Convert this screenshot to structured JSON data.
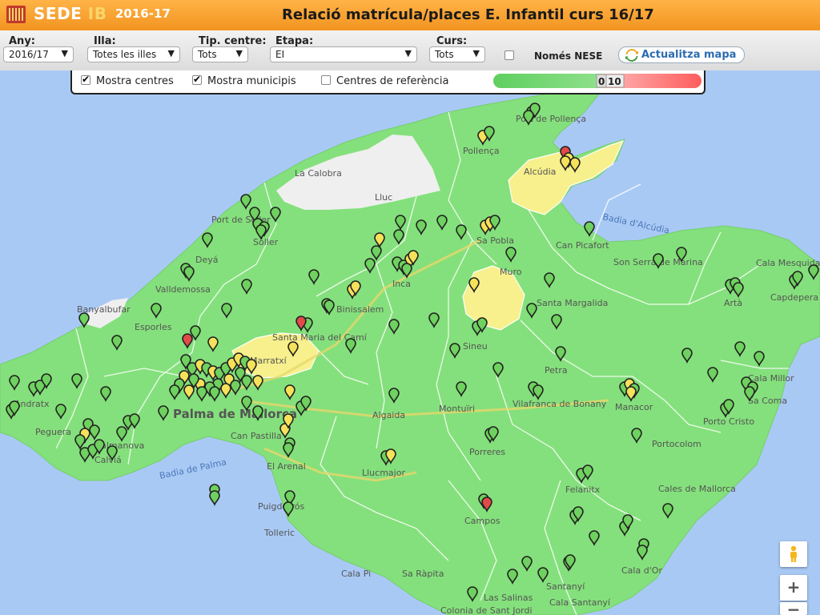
{
  "header": {
    "logo_main": "SEDE ",
    "logo_ib": "IB",
    "year": "2016-17",
    "title": "Relació matrícula/places E. Infantil curs 16/17",
    "colors": {
      "bar": "#f29421",
      "logo_ib": "#f8d56a"
    }
  },
  "filters": {
    "any": {
      "label": "Any:",
      "value": "2016/17"
    },
    "illa": {
      "label": "Illa:",
      "value": "Totes les illes"
    },
    "tip_centre": {
      "label": "Tip. centre:",
      "value": "Tots"
    },
    "etapa": {
      "label": "Etapa:",
      "value": "EI"
    },
    "curs": {
      "label": "Curs:",
      "value": "Tots"
    },
    "nese": {
      "label": "Només NESE",
      "checked": false
    },
    "refresh": {
      "label": "Actualitza mapa",
      "icon": "refresh-icon"
    }
  },
  "map_options": {
    "mostra_centres": {
      "label": "Mostra centres",
      "checked": true
    },
    "mostra_municipis": {
      "label": "Mostra municipis",
      "checked": true
    },
    "centres_referencia": {
      "label": "Centres de referència",
      "checked": false
    },
    "legend": {
      "min_label": "0",
      "max_label": "10",
      "colors": [
        "#5fcf5f",
        "#ff5c5c"
      ]
    }
  },
  "map": {
    "colors": {
      "sea": "#a9c9f5",
      "green": "#84e07c",
      "yellow": "#f7f08c",
      "white": "#efefef",
      "road": "#e6d86c"
    },
    "place_labels": [
      "Port de Pollença",
      "Pollença",
      "Alcúdia",
      "La Calobra",
      "Lluc",
      "Port de Sóller",
      "Sóller",
      "Deyá",
      "Valldemossa",
      "Banyalbufar",
      "Esporles",
      "Santa Maria del Camí",
      "Binissalem",
      "Inca",
      "Sa Pobla",
      "Muro",
      "Can Picafort",
      "Son Serra de Marina",
      "Santa Margalida",
      "Artà",
      "Cala Mesquida",
      "Capdepera",
      "Sineu",
      "Petra",
      "Cala Millor",
      "Sa Coma",
      "Manacor",
      "Porto Cristo",
      "Andratx",
      "Peguera",
      "Palmanova",
      "Calviá",
      "Palma de Mallorca",
      "Marratxí",
      "Can Pastilla",
      "Algaida",
      "Montuïri",
      "Vilafranca de Bonany",
      "Porreres",
      "El Arenal",
      "Llucmajor",
      "Felanitx",
      "Portocolom",
      "Cales de Mallorca",
      "Campos",
      "Puigderrós",
      "Tolleric",
      "Cala Pi",
      "Sa Ràpita",
      "Santanyí",
      "Cala d'Or",
      "Las Salinas",
      "Cala Santanyí",
      "Colonia de Sant Jordi",
      "Badia de Palma",
      "Badia d'Alcúdia"
    ],
    "marker_colors": {
      "green": "#6fd15f",
      "yellow": "#f5e25a",
      "red": "#e24a4a"
    }
  }
}
